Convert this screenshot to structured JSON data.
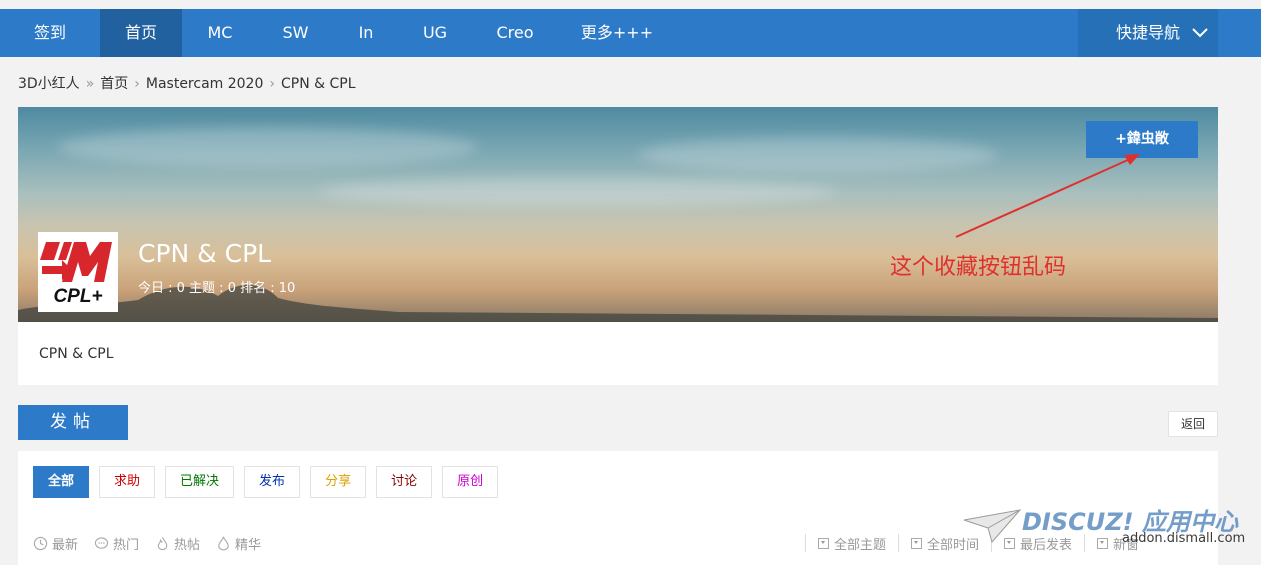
{
  "nav": {
    "items": [
      {
        "label": "签到"
      },
      {
        "label": "首页"
      },
      {
        "label": "MC"
      },
      {
        "label": "SW"
      },
      {
        "label": "In"
      },
      {
        "label": "UG"
      },
      {
        "label": "Creo"
      },
      {
        "label": "更多+++"
      }
    ],
    "active_index": 1,
    "quick_nav_label": "快捷导航"
  },
  "breadcrumb": {
    "items": [
      "3D小红人",
      "首页",
      "Mastercam 2020",
      "CPN & CPL"
    ],
    "separators": [
      "»",
      "›",
      "›"
    ]
  },
  "forum": {
    "title": "CPN & CPL",
    "stats": "今日 : 0   主题 : 0   排名 : 10",
    "logo_text": "CPL+",
    "favorite_button": "+鍏虫敞",
    "description": "CPN & CPL"
  },
  "annotation": {
    "note": "这个收藏按钮乱码",
    "color": "#e0302e"
  },
  "actions": {
    "post_button": "发帖",
    "back_button": "返回"
  },
  "type_tabs": [
    {
      "label": "全部",
      "color": "#ffffff"
    },
    {
      "label": "求助",
      "color": "#cc0000"
    },
    {
      "label": "已解决",
      "color": "#007700"
    },
    {
      "label": "发布",
      "color": "#0033aa"
    },
    {
      "label": "分享",
      "color": "#e0a000"
    },
    {
      "label": "讨论",
      "color": "#880000"
    },
    {
      "label": "原创",
      "color": "#cc00cc"
    }
  ],
  "filters": [
    {
      "label": "最新",
      "icon": "clock-icon"
    },
    {
      "label": "热门",
      "icon": "chat-icon"
    },
    {
      "label": "热帖",
      "icon": "flame-icon"
    },
    {
      "label": "精华",
      "icon": "drop-icon"
    }
  ],
  "sorts": [
    {
      "label": "全部主题"
    },
    {
      "label": "全部时间"
    },
    {
      "label": "最后发表"
    },
    {
      "label": "新窗"
    }
  ],
  "watermark": {
    "brand": "DISCUZ! 应用中心",
    "url": "addon.dismall.com"
  },
  "colors": {
    "primary": "#2d7bc8",
    "nav_active": "#21619f",
    "page_bg": "#f2f2f2"
  }
}
